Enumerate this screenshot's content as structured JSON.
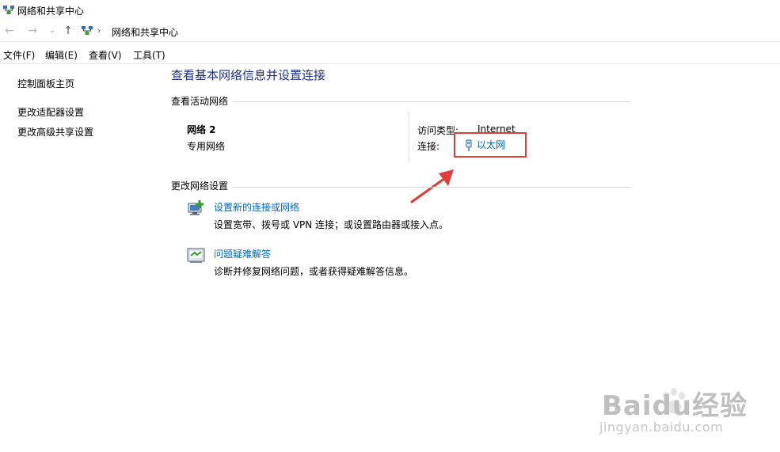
{
  "window": {
    "title": "网络和共享中心"
  },
  "address": {
    "path": "网络和共享中心",
    "separator": "›"
  },
  "menu": [
    "文件(F)",
    "编辑(E)",
    "查看(V)",
    "工具(T)"
  ],
  "sidebar": {
    "home": "控制面板主页",
    "items": [
      "更改适配器设置",
      "更改高级共享设置"
    ]
  },
  "main": {
    "title": "查看基本网络信息并设置连接",
    "active_section": "查看活动网络",
    "network": {
      "name": "网络 2",
      "type": "专用网络",
      "access_label": "访问类型:",
      "access_value": "Internet",
      "connection_label": "连接:",
      "connection_value": "以太网"
    },
    "change_section": "更改网络设置",
    "tasks": [
      {
        "link": "设置新的连接或网络",
        "desc": "设置宽带、拨号或 VPN 连接；或设置路由器或接入点。"
      },
      {
        "link": "问题疑难解答",
        "desc": "诊断并修复网络问题，或者获得疑难解答信息。"
      }
    ]
  },
  "watermark": {
    "brand": "Baidu经验",
    "url": "jingyan.baidu.com"
  },
  "colors": {
    "link": "#0066cc",
    "title": "#1e3287",
    "highlight": "#e23b3b"
  },
  "icons": [
    "network-icon",
    "back-arrow-icon",
    "forward-arrow-icon",
    "up-arrow-icon",
    "ethernet-icon",
    "new-connection-icon",
    "troubleshoot-icon",
    "annotation-arrow-icon"
  ]
}
